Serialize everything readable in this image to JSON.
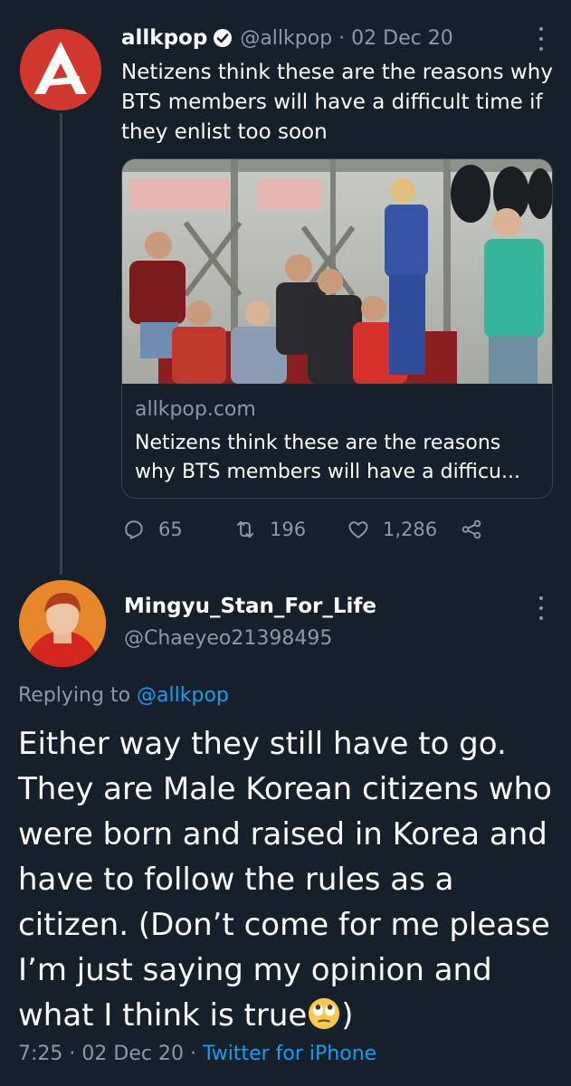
{
  "tweet": {
    "name": "allkpop",
    "handle": "@allkpop",
    "date": "02 Dec 20",
    "text": "Netizens think these are the reasons why BTS members will have a difficult time if they enlist too soon",
    "card": {
      "domain": "allkpop.com",
      "title": "Netizens think these are the reasons why BTS members will have a difficu..."
    },
    "stats": {
      "replies": "65",
      "retweets": "196",
      "likes": "1,286"
    }
  },
  "reply": {
    "name": "Mingyu_Stan_For_Life",
    "handle": "@Chaeyeo21398495",
    "replying_prefix": "Replying to",
    "replying_handle": "@allkpop",
    "text": "Either way they still have to go. They are Male Korean citizens who were born and raised in Korea and have to follow the rules as a citizen. (Don’t come for me please I’m just saying my opinion and what I think is true",
    "text_end": ")",
    "emoji": "face-with-rolling-eyes",
    "time": "7:25",
    "date": "02 Dec 20",
    "source": "Twitter for iPhone"
  },
  "icons": {
    "verified": "verified-badge-icon",
    "more": "kebab-menu-icon",
    "reply": "reply-icon",
    "retweet": "retweet-icon",
    "like": "heart-icon",
    "share": "share-icon"
  },
  "colors": {
    "background": "#15202b",
    "text": "#ffffff",
    "muted": "#8b98a5",
    "link": "#1d9bf0",
    "border": "#38444d",
    "brand_red": "#d1372b"
  }
}
